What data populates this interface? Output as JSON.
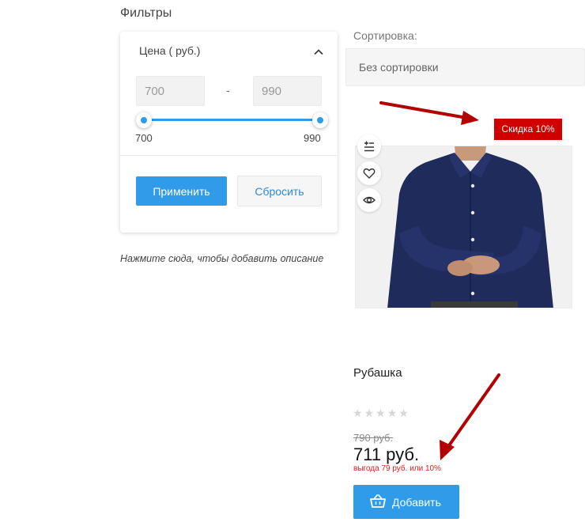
{
  "filters": {
    "title": "Фильтры",
    "price": {
      "header": "Цена ( руб.)",
      "min_value": "700",
      "max_value": "990",
      "separator": "-",
      "range_min_label": "700",
      "range_max_label": "990",
      "selected_range_fraction": [
        0,
        1
      ]
    },
    "apply_label": "Применить",
    "reset_label": "Сбросить",
    "description_hint": "Нажмите сюда, чтобы добавить описание"
  },
  "sorting": {
    "label": "Сортировка:",
    "selected": "Без сортировки"
  },
  "product": {
    "badge": "Скидка 10%",
    "name": "Рубашка",
    "rating": 0,
    "rating_max": 5,
    "old_price": "790 руб.",
    "price": "711 руб.",
    "saving": "выгода 79 руб. или 10%",
    "add_label": "Добавить",
    "action_icons": [
      "compare-icon",
      "heart-icon",
      "eye-icon"
    ]
  },
  "colors": {
    "accent": "#2f9be9",
    "badge": "#d00000",
    "annotation_arrow": "#b30000"
  }
}
